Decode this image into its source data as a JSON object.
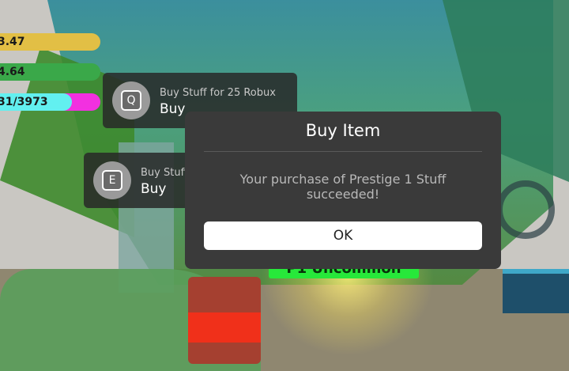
{
  "stats": [
    {
      "text": "3.47"
    },
    {
      "text": "4.64"
    },
    {
      "text": "31/3973",
      "fill_fraction": 0.72
    }
  ],
  "prompts": {
    "q": {
      "key": "Q",
      "object": "Buy Stuff for 25 Robux",
      "action": "Buy"
    },
    "e": {
      "key": "E",
      "object": "Buy Stuff",
      "action": "Buy"
    }
  },
  "scene": {
    "rarity_label": "P1 Uncommon",
    "colors": {
      "rarity": "#27e83a",
      "glow": "#ffe878"
    }
  },
  "modal": {
    "title": "Buy Item",
    "message": "Your purchase of Prestige 1 Stuff succeeded!",
    "ok_label": "OK"
  }
}
